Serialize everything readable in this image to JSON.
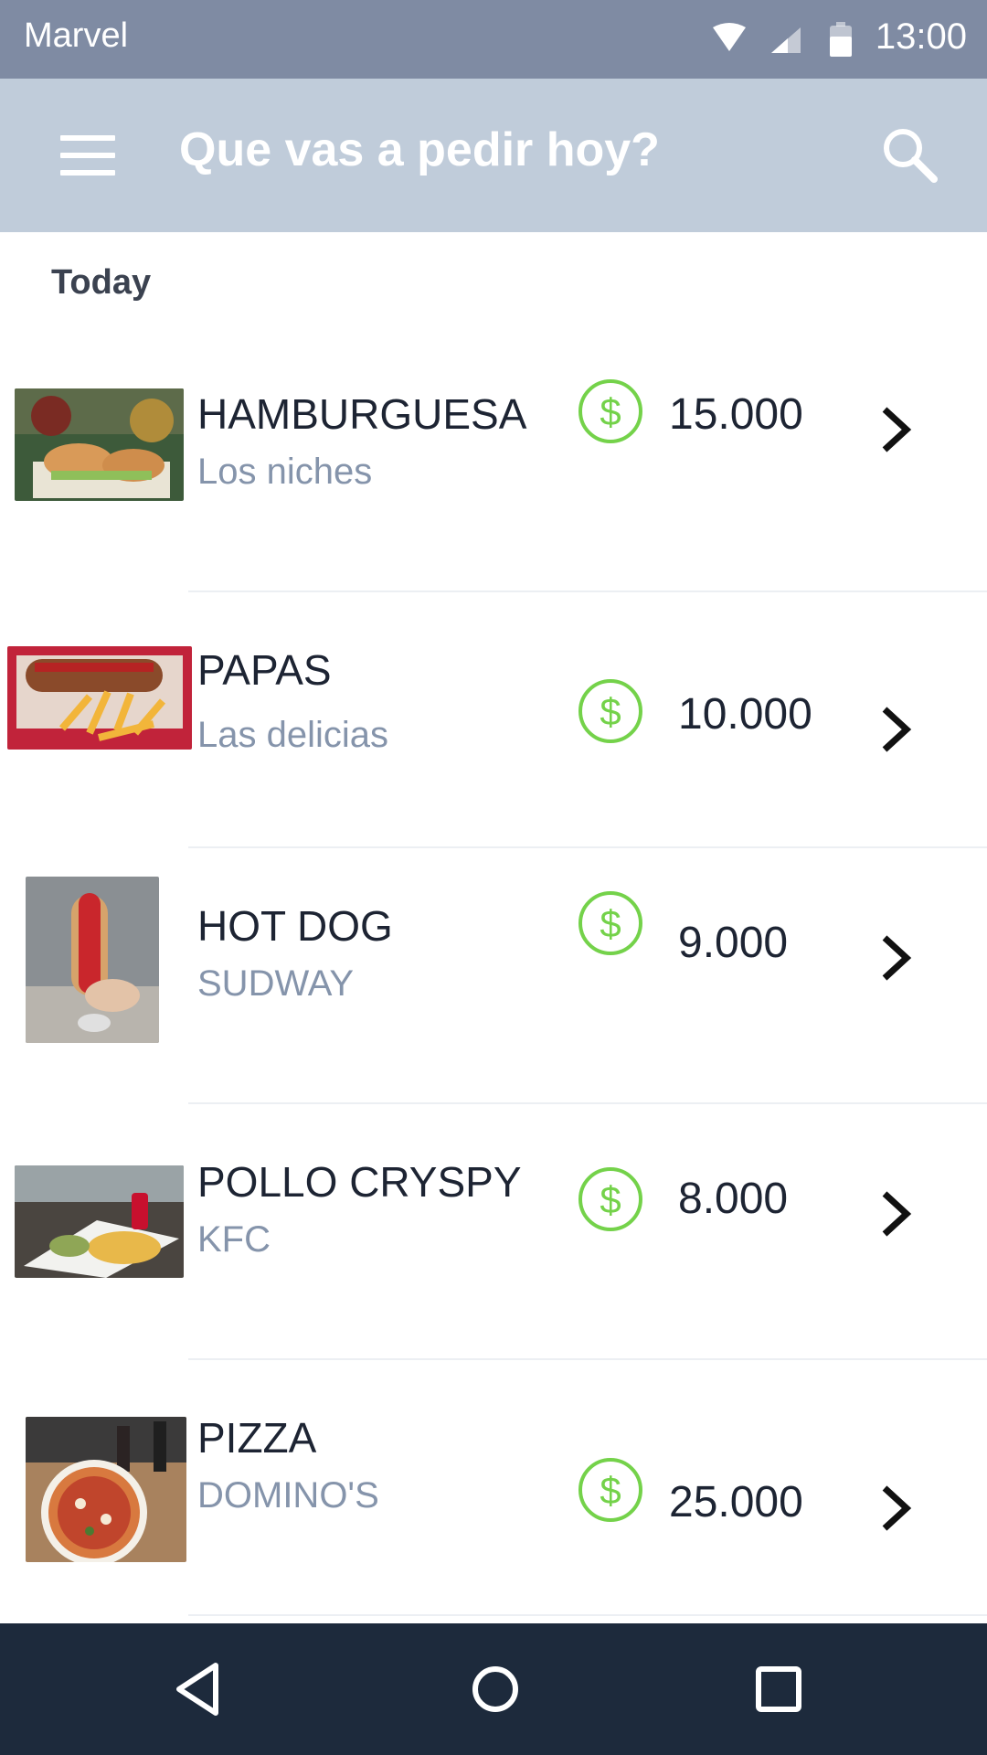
{
  "status_bar": {
    "app_name": "Marvel",
    "time": "13:00",
    "icons": [
      "wifi-icon",
      "signal-icon",
      "battery-icon"
    ]
  },
  "app_bar": {
    "title": "Que vas a pedir hoy?",
    "icons": [
      "menu-icon",
      "search-icon"
    ]
  },
  "section": {
    "header": "Today"
  },
  "items": [
    {
      "title": "HAMBURGUESA",
      "subtitle": "Los niches",
      "price": "15.000",
      "image": "burger-photo"
    },
    {
      "title": "PAPAS",
      "subtitle": "Las delicias",
      "price": "10.000",
      "image": "fries-photo"
    },
    {
      "title": "HOT DOG",
      "subtitle": "SUDWAY",
      "price": "9.000",
      "image": "hotdog-photo"
    },
    {
      "title": "POLLO CRYSPY",
      "subtitle": "KFC",
      "price": "8.000",
      "image": "chicken-photo"
    },
    {
      "title": "PIZZA",
      "subtitle": "DOMINO'S",
      "price": "25.000",
      "image": "pizza-photo"
    }
  ],
  "nav_bar": {
    "icons": [
      "back-icon",
      "home-icon",
      "recents-icon"
    ]
  },
  "colors": {
    "status_bar": "#7f8ba3",
    "app_bar": "#c0ccda",
    "price_icon": "#74d24a",
    "nav_bar": "#1d2a3c",
    "subtitle": "#8594ab"
  }
}
